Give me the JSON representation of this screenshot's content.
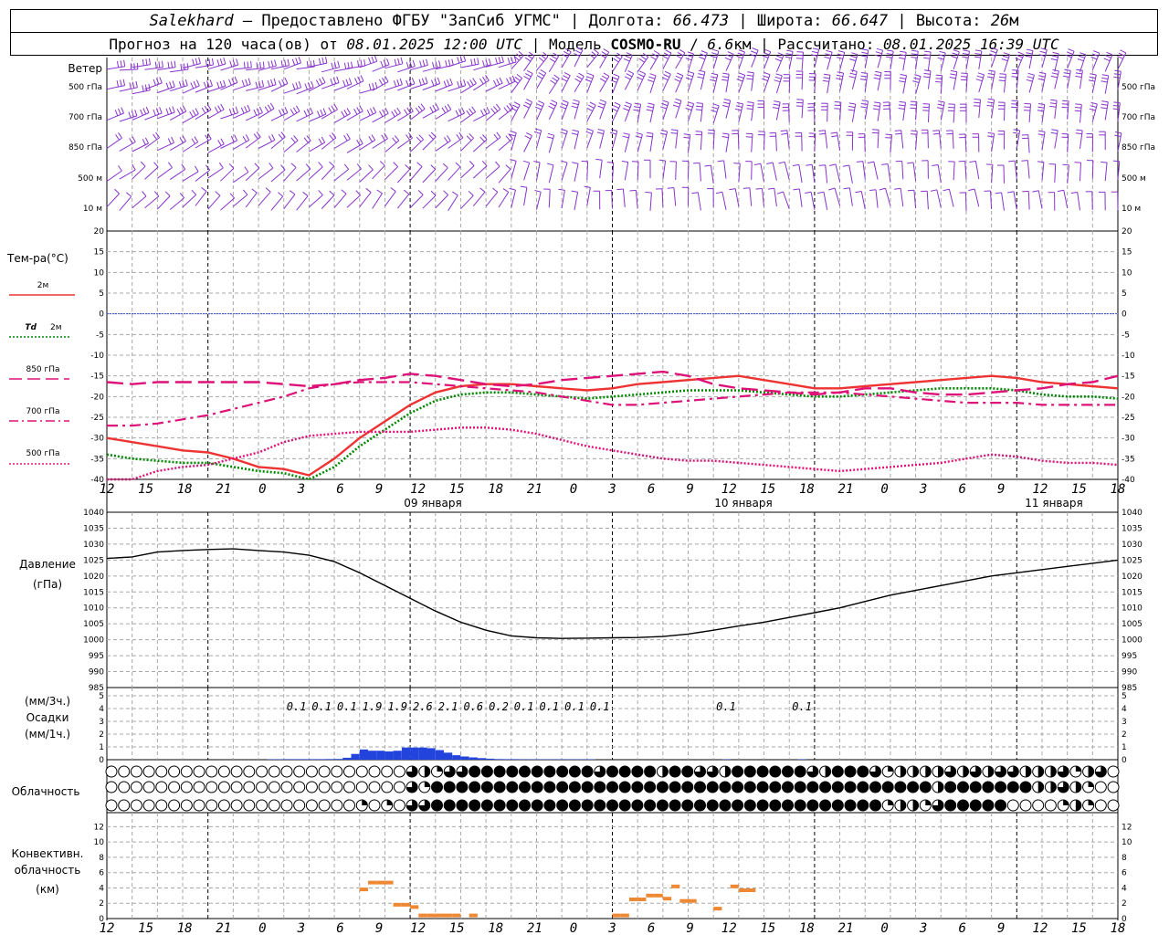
{
  "header": {
    "station": "Salekhard",
    "provided": " – Предоставлено ФГБУ \"ЗапСиб УГМС\" | Долгота: ",
    "longitude": "66.473",
    "lat_label": " | Широта: ",
    "latitude": "66.647",
    "alt_label": " | Высота: ",
    "altitude": "26",
    "alt_unit": "м",
    "forecast_label": "Прогноз на 120 часа(ов) от ",
    "forecast_time": "08.01.2025 12:00 UTC",
    "model_label": " | Модель ",
    "model": "COSMO-RU",
    "model_sep": " / ",
    "resolution": "6.6",
    "res_unit": "км",
    "calc_label": " | Рассчитано: ",
    "calc_time": "08.01.2025 16:39 UTC"
  },
  "labels": {
    "wind": "Ветер",
    "wind_levels": [
      "500 гПа",
      "700 гПа",
      "850 гПа",
      "500 м",
      "10 м"
    ],
    "temp_title": "Тем-ра(°C)",
    "legend_2m": "2м",
    "legend_td": "Td",
    "legend_td_2m": "2м",
    "legend_850": "850 гПа",
    "legend_700": "700 гПа",
    "legend_500": "500 гПа",
    "pressure_1": "Давление",
    "pressure_2": "(гПа)",
    "precip_1": "(мм/3ч.)",
    "precip_2": "Осадки",
    "precip_3": "(мм/1ч.)",
    "cloud": "Облачность",
    "conv_1": "Конвективн.",
    "conv_2": "облачность",
    "conv_3": "(км)",
    "date_1": "09 января",
    "date_2": "10 января",
    "date_3": "11 января"
  },
  "colors": {
    "t2m": "#ee3333",
    "td2m": "#008800",
    "t850": "#dd1177",
    "t700": "#dd1177",
    "t500": "#dd1177",
    "zero": "#3355cc",
    "wind": "#8833cc",
    "precip": "#2244dd",
    "conv": "#ee8833"
  },
  "chart_data": [
    {
      "type": "line",
      "panel": "temperature",
      "x_hours": [
        0,
        3,
        6,
        9,
        12,
        15,
        18,
        21,
        24,
        27,
        30,
        33,
        36,
        39,
        42,
        45,
        48,
        51,
        54,
        57,
        60,
        63,
        66,
        69,
        72,
        75,
        78,
        81,
        84,
        87,
        90,
        93,
        96,
        99,
        102,
        105,
        108,
        111,
        114,
        117,
        120
      ],
      "xticks": [
        "12",
        "15",
        "18",
        "21",
        "0",
        "3",
        "6",
        "9",
        "12",
        "15",
        "18",
        "21",
        "0",
        "3",
        "6",
        "9",
        "12",
        "15",
        "18",
        "21",
        "0",
        "3",
        "6",
        "9",
        "12",
        "15",
        "18"
      ],
      "ylim": [
        -40,
        20
      ],
      "yticks": [
        -40,
        -35,
        -30,
        -25,
        -20,
        -15,
        -10,
        -5,
        0,
        5,
        10,
        15,
        20
      ],
      "series": [
        {
          "name": "2м",
          "style": "solid",
          "values": [
            -30,
            -31,
            -32,
            -33,
            -33.5,
            -35,
            -37,
            -37.5,
            -39,
            -35,
            -30,
            -26,
            -22,
            -19,
            -17.5,
            -17,
            -17,
            -17.5,
            -18,
            -18.5,
            -18,
            -17,
            -16.5,
            -16,
            -15.5,
            -15,
            -16,
            -17,
            -18,
            -18,
            -17.5,
            -17,
            -16.5,
            -16,
            -15.5,
            -15,
            -15.5,
            -16.5,
            -17,
            -17.5,
            -18
          ]
        },
        {
          "name": "Td 2м",
          "style": "dotted",
          "values": [
            -34,
            -35,
            -35.5,
            -36,
            -36,
            -37,
            -38,
            -38.5,
            -41,
            -37,
            -32,
            -28,
            -24,
            -21,
            -19.5,
            -19,
            -19,
            -19.5,
            -20,
            -20.5,
            -20,
            -19.5,
            -19,
            -18.5,
            -18.5,
            -18.5,
            -19,
            -19.5,
            -20,
            -20,
            -19.5,
            -19,
            -18.5,
            -18,
            -18,
            -18,
            -18.5,
            -19.5,
            -20,
            -20,
            -20.5
          ]
        },
        {
          "name": "850 гПа",
          "style": "longdash",
          "values": [
            -16.5,
            -17,
            -16.5,
            -16.5,
            -16.5,
            -16.5,
            -16.5,
            -17,
            -17.5,
            -17,
            -16,
            -15.5,
            -14.5,
            -15,
            -16,
            -17,
            -17.5,
            -17,
            -16,
            -15.5,
            -15,
            -14.5,
            -14,
            -15,
            -17,
            -18,
            -18.5,
            -19,
            -19.5,
            -19,
            -18,
            -18,
            -19,
            -19.5,
            -19.5,
            -19,
            -18.5,
            -18,
            -17,
            -16.5,
            -15
          ]
        },
        {
          "name": "700 гПа",
          "style": "dashdot",
          "values": [
            -27,
            -27,
            -26.5,
            -25.5,
            -24.5,
            -23,
            -21.5,
            -20,
            -18,
            -17,
            -16.5,
            -16.5,
            -16.5,
            -17,
            -17.5,
            -18,
            -18.5,
            -19,
            -20,
            -21,
            -22,
            -22,
            -21.5,
            -21,
            -20.5,
            -20,
            -19.5,
            -19,
            -19,
            -19,
            -19.5,
            -20,
            -20.5,
            -21,
            -21.5,
            -21.5,
            -21.5,
            -22,
            -22,
            -22,
            -22
          ]
        },
        {
          "name": "500 гПа",
          "style": "dotted",
          "values": [
            -43,
            -40,
            -38,
            -37,
            -36.5,
            -35,
            -33.5,
            -31,
            -29.5,
            -29,
            -28.5,
            -28.5,
            -28.5,
            -28,
            -27.5,
            -27.5,
            -28,
            -29,
            -30.5,
            -32,
            -33,
            -34,
            -35,
            -35.5,
            -35.5,
            -36,
            -36.5,
            -37,
            -37.5,
            -38,
            -37.5,
            -37,
            -36.5,
            -36,
            -35,
            -34,
            -34.5,
            -35.5,
            -36,
            -36,
            -36.5
          ]
        }
      ]
    },
    {
      "type": "line",
      "panel": "pressure",
      "ylabel": "Давление (гПа)",
      "ylim": [
        985,
        1040
      ],
      "yticks": [
        985,
        990,
        995,
        1000,
        1005,
        1010,
        1015,
        1020,
        1025,
        1030,
        1035,
        1040
      ],
      "x_hours": [
        0,
        3,
        6,
        9,
        12,
        15,
        18,
        21,
        24,
        27,
        30,
        33,
        36,
        39,
        42,
        45,
        48,
        51,
        54,
        57,
        60,
        63,
        66,
        69,
        72,
        75,
        78,
        81,
        84,
        87,
        90,
        93,
        96,
        99,
        102,
        105,
        108,
        111,
        114,
        117,
        120
      ],
      "values": [
        1025.5,
        1026,
        1027.5,
        1028,
        1028.3,
        1028.5,
        1028,
        1027.5,
        1026.5,
        1024.5,
        1021,
        1017,
        1013,
        1009,
        1005.5,
        1003,
        1001.2,
        1000.6,
        1000.4,
        1000.5,
        1000.6,
        1000.7,
        1001,
        1001.8,
        1003,
        1004.3,
        1005.5,
        1007,
        1008.5,
        1010,
        1012,
        1014,
        1015.5,
        1017,
        1018.5,
        1020,
        1021,
        1022,
        1023,
        1024,
        1025
      ]
    },
    {
      "type": "bar",
      "panel": "precipitation",
      "ylabel": "Осадки (мм/3ч.) (мм/1ч.)",
      "ylim": [
        0,
        5
      ],
      "yticks": [
        0,
        1,
        2,
        3,
        4,
        5
      ],
      "labels_3h": [
        {
          "hour": 22.5,
          "value": "0.1"
        },
        {
          "hour": 25.5,
          "value": "0.1"
        },
        {
          "hour": 28.5,
          "value": "0.1"
        },
        {
          "hour": 31.5,
          "value": "1.9"
        },
        {
          "hour": 34.5,
          "value": "1.9"
        },
        {
          "hour": 37.5,
          "value": "2.6"
        },
        {
          "hour": 40.5,
          "value": "2.1"
        },
        {
          "hour": 43.5,
          "value": "0.6"
        },
        {
          "hour": 46.5,
          "value": "0.2"
        },
        {
          "hour": 49.5,
          "value": "0.1"
        },
        {
          "hour": 52.5,
          "value": "0.1"
        },
        {
          "hour": 55.5,
          "value": "0.1"
        },
        {
          "hour": 58.5,
          "value": "0.1"
        },
        {
          "hour": 73.5,
          "value": "0.1"
        },
        {
          "hour": 82.5,
          "value": "0.1"
        }
      ],
      "hourly": [
        {
          "hour": 20,
          "value": 0.03
        },
        {
          "hour": 21,
          "value": 0.03
        },
        {
          "hour": 22,
          "value": 0.04
        },
        {
          "hour": 23,
          "value": 0.04
        },
        {
          "hour": 24,
          "value": 0.04
        },
        {
          "hour": 25,
          "value": 0.04
        },
        {
          "hour": 26,
          "value": 0.04
        },
        {
          "hour": 27,
          "value": 0.05
        },
        {
          "hour": 28,
          "value": 0.06
        },
        {
          "hour": 29,
          "value": 0.15
        },
        {
          "hour": 30,
          "value": 0.45
        },
        {
          "hour": 31,
          "value": 0.8
        },
        {
          "hour": 32,
          "value": 0.7
        },
        {
          "hour": 33,
          "value": 0.7
        },
        {
          "hour": 34,
          "value": 0.65
        },
        {
          "hour": 35,
          "value": 0.7
        },
        {
          "hour": 36,
          "value": 0.95
        },
        {
          "hour": 37,
          "value": 0.95
        },
        {
          "hour": 38,
          "value": 0.95
        },
        {
          "hour": 39,
          "value": 0.9
        },
        {
          "hour": 40,
          "value": 0.75
        },
        {
          "hour": 41,
          "value": 0.55
        },
        {
          "hour": 42,
          "value": 0.35
        },
        {
          "hour": 43,
          "value": 0.25
        },
        {
          "hour": 44,
          "value": 0.18
        },
        {
          "hour": 45,
          "value": 0.12
        },
        {
          "hour": 46,
          "value": 0.08
        },
        {
          "hour": 47,
          "value": 0.05
        },
        {
          "hour": 48,
          "value": 0.04
        },
        {
          "hour": 49,
          "value": 0.04
        },
        {
          "hour": 50,
          "value": 0.03
        },
        {
          "hour": 51,
          "value": 0.03
        },
        {
          "hour": 52,
          "value": 0.03
        },
        {
          "hour": 53,
          "value": 0.03
        },
        {
          "hour": 54,
          "value": 0.03
        },
        {
          "hour": 55,
          "value": 0.03
        },
        {
          "hour": 56,
          "value": 0.03
        },
        {
          "hour": 57,
          "value": 0.03
        },
        {
          "hour": 58,
          "value": 0.03
        },
        {
          "hour": 74,
          "value": 0.03
        },
        {
          "hour": 83,
          "value": 0.03
        }
      ]
    },
    {
      "type": "table",
      "panel": "cloudiness",
      "rows": 3,
      "columns": 81,
      "cover_fraction": {
        "top": [
          0,
          0,
          0,
          0,
          0,
          0,
          0,
          0,
          0,
          0,
          0,
          0,
          0,
          0,
          0,
          0,
          0,
          0,
          0,
          0,
          0,
          0,
          0,
          0,
          0.75,
          0.5,
          0.25,
          0.75,
          0.75,
          1,
          1,
          1,
          1,
          1,
          1,
          1,
          1,
          1,
          1,
          0.75,
          1,
          1,
          1,
          1,
          0.5,
          1,
          1,
          0.75,
          0.75,
          0.5,
          1,
          1,
          1,
          1,
          1,
          1,
          0.75,
          0.5,
          1,
          1,
          1,
          0.75,
          0.25,
          0.5,
          0.5,
          0.5,
          0.5,
          0.75,
          0.5,
          0.75,
          0.5,
          0.75,
          0.75,
          0.5,
          0.5,
          0.5,
          0.75,
          0.25,
          0.5,
          0.75,
          0
        ],
        "middle": [
          0,
          0,
          0,
          0,
          0,
          0,
          0,
          0,
          0,
          0,
          0,
          0,
          0,
          0,
          0,
          0,
          0,
          0,
          0,
          0,
          0,
          0,
          0,
          0,
          0.75,
          0.25,
          1,
          1,
          1,
          1,
          1,
          1,
          1,
          1,
          1,
          1,
          1,
          1,
          1,
          1,
          1,
          1,
          1,
          1,
          1,
          1,
          1,
          1,
          1,
          1,
          1,
          1,
          1,
          1,
          1,
          1,
          1,
          1,
          1,
          1,
          1,
          1,
          1,
          1,
          1,
          1,
          0.5,
          1,
          1,
          1,
          1,
          1,
          1,
          1,
          0.5,
          0.5,
          0.75,
          0.5,
          0.25,
          0,
          0
        ],
        "bottom": [
          0,
          0,
          0,
          0,
          0,
          0,
          0,
          0,
          0,
          0,
          0,
          0,
          0,
          0,
          0,
          0,
          0,
          0,
          0,
          0,
          0.25,
          0,
          0.25,
          0,
          0.75,
          0.75,
          1,
          1,
          1,
          1,
          1,
          1,
          1,
          1,
          1,
          1,
          1,
          1,
          1,
          1,
          1,
          1,
          1,
          1,
          1,
          1,
          1,
          1,
          1,
          1,
          1,
          1,
          1,
          1,
          1,
          1,
          1,
          1,
          1,
          1,
          1,
          1,
          0.25,
          0.5,
          0.5,
          0.25,
          0.75,
          1,
          1,
          1,
          1,
          1,
          0,
          0,
          0,
          0,
          0.25,
          0.5,
          0.25,
          0,
          0
        ]
      }
    },
    {
      "type": "bar",
      "panel": "convective_cloud",
      "ylabel": "Конвективн. облачность (км)",
      "ylim": [
        0,
        13
      ],
      "yticks": [
        0,
        2,
        4,
        6,
        8,
        10,
        12
      ],
      "segments": [
        {
          "hour": 30.5,
          "value": 3.8
        },
        {
          "hour": 31.5,
          "value": 4.7
        },
        {
          "hour": 32.5,
          "value": 4.7
        },
        {
          "hour": 33.5,
          "value": 4.7
        },
        {
          "hour": 34.5,
          "value": 1.8
        },
        {
          "hour": 35.5,
          "value": 1.8
        },
        {
          "hour": 36.5,
          "value": 1.5
        },
        {
          "hour": 37.5,
          "value": 0.4
        },
        {
          "hour": 38.5,
          "value": 0.4
        },
        {
          "hour": 39.5,
          "value": 0.4
        },
        {
          "hour": 40.5,
          "value": 0.4
        },
        {
          "hour": 41.5,
          "value": 0.4
        },
        {
          "hour": 43.5,
          "value": 0.4
        },
        {
          "hour": 60.5,
          "value": 0.4
        },
        {
          "hour": 61.5,
          "value": 0.4
        },
        {
          "hour": 62.5,
          "value": 2.5
        },
        {
          "hour": 63.5,
          "value": 2.5
        },
        {
          "hour": 64.5,
          "value": 3
        },
        {
          "hour": 65.5,
          "value": 3
        },
        {
          "hour": 66.5,
          "value": 2.6
        },
        {
          "hour": 67.5,
          "value": 4.2
        },
        {
          "hour": 68.5,
          "value": 2.3
        },
        {
          "hour": 69.5,
          "value": 2.3
        },
        {
          "hour": 72.5,
          "value": 1.3
        },
        {
          "hour": 74.5,
          "value": 4.2
        },
        {
          "hour": 75.5,
          "value": 3.7
        },
        {
          "hour": 76.5,
          "value": 3.7
        }
      ]
    },
    {
      "type": "other",
      "panel": "wind_barbs",
      "levels": [
        "500 гПа",
        "700 гПа",
        "850 гПа",
        "500 м",
        "10 м"
      ]
    }
  ]
}
